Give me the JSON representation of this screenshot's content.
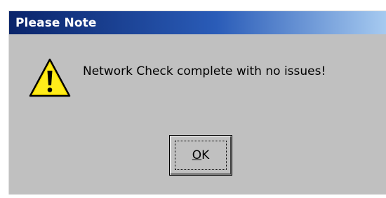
{
  "dialog": {
    "title": "Please Note",
    "message": "Network Check complete with no issues!",
    "icon": "warning-icon",
    "ok_button": {
      "accelerator": "O",
      "rest": "K"
    }
  },
  "colors": {
    "titlebar_start": "#0a246a",
    "titlebar_end": "#a6caf0",
    "dialog_face": "#c0c0c0",
    "icon_fill": "#f8e000"
  }
}
